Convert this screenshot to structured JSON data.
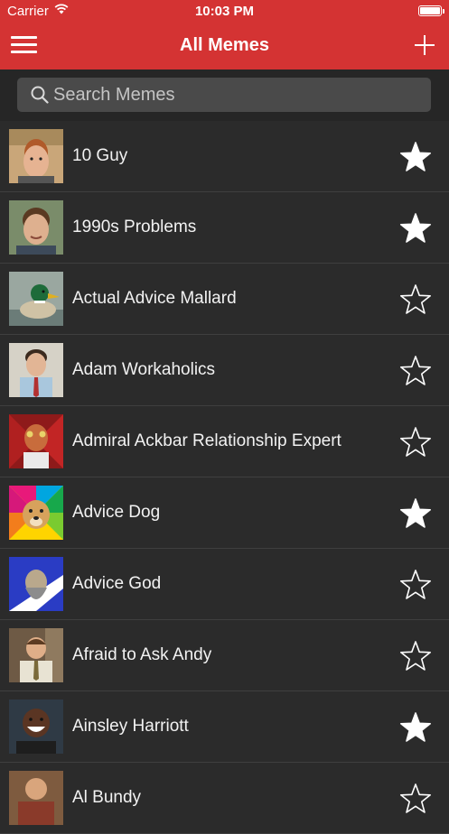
{
  "status_bar": {
    "carrier": "Carrier",
    "time": "10:03 PM"
  },
  "header": {
    "title": "All Memes",
    "menu_icon": "hamburger-icon",
    "add_icon": "plus-icon"
  },
  "search": {
    "placeholder": "Search Memes",
    "value": ""
  },
  "colors": {
    "header": "#d43333",
    "background": "#2b2b2b",
    "search_bar": "#262626",
    "search_field": "#4a4a4a"
  },
  "memes": [
    {
      "name": "10 Guy",
      "favorite": true,
      "thumb": "face-redhead"
    },
    {
      "name": "1990s Problems",
      "favorite": true,
      "thumb": "face-brown-hair"
    },
    {
      "name": "Actual Advice Mallard",
      "favorite": false,
      "thumb": "mallard-duck"
    },
    {
      "name": "Adam Workaholics",
      "favorite": false,
      "thumb": "man-with-tie"
    },
    {
      "name": "Admiral Ackbar Relationship Expert",
      "favorite": false,
      "thumb": "admiral-ackbar"
    },
    {
      "name": "Advice Dog",
      "favorite": true,
      "thumb": "dog-color-wheel"
    },
    {
      "name": "Advice God",
      "favorite": false,
      "thumb": "god-blue-white"
    },
    {
      "name": "Afraid to Ask Andy",
      "favorite": false,
      "thumb": "andy-office"
    },
    {
      "name": "Ainsley Harriott",
      "favorite": true,
      "thumb": "ainsley-smile"
    },
    {
      "name": "Al Bundy",
      "favorite": false,
      "thumb": "al-bundy"
    }
  ]
}
